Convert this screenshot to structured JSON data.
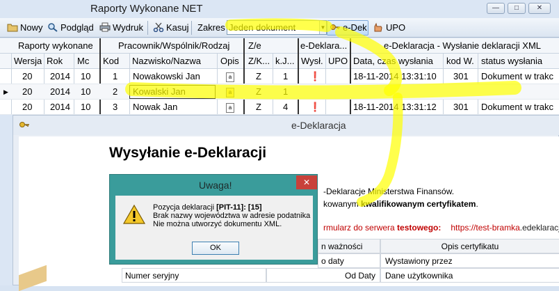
{
  "window": {
    "title": "Raporty Wykonane NET"
  },
  "toolbar": {
    "new_label": "Nowy",
    "preview_label": "Podgląd",
    "print_label": "Wydruk",
    "delete_label": "Kasuj",
    "range_label": "Zakres",
    "range_value": "Jeden dokument",
    "edek_label": "e-Dek",
    "upo_label": "UPO"
  },
  "grid": {
    "group_headers": [
      "Raporty wykonane",
      "Pracownik/Wspólnik/Rodzaj",
      "Z/e",
      "e-Deklara...",
      "e-Deklaracja - Wysłanie deklaracji XML"
    ],
    "columns": [
      "Wersja",
      "Rok",
      "Mc",
      "Kod",
      "Nazwisko/Nazwa",
      "Opis",
      "Z/K...",
      "k.J...",
      "Wysł.",
      "UPO",
      "Data, czas wysłania",
      "kod W.",
      "status wysłania"
    ],
    "rows": [
      {
        "wersja": "20",
        "rok": "2014",
        "mc": "10",
        "kod": "1",
        "nazwa": "Nowakowski Jan",
        "zk": "Z",
        "kj": "1",
        "sent": true,
        "data": "18-11-2014 13:31:10",
        "kodw": "301",
        "status": "Dokument w trakc"
      },
      {
        "wersja": "20",
        "rok": "2014",
        "mc": "10",
        "kod": "2",
        "nazwa": "Kowalski Jan",
        "zk": "Z",
        "kj": "1",
        "sent": false,
        "data": "",
        "kodw": "",
        "status": ""
      },
      {
        "wersja": "20",
        "rok": "2014",
        "mc": "10",
        "kod": "3",
        "nazwa": "Nowak Jan",
        "zk": "Z",
        "kj": "4",
        "sent": true,
        "data": "18-11-2014 13:31:12",
        "kodw": "301",
        "status": "Dokument w trakc"
      }
    ]
  },
  "edek_window": {
    "title": "e-Deklaracja",
    "heading": "Wysyłanie e-Deklaracji",
    "line1": "-Deklaracje Ministerstwa Finansów.",
    "line2_pre": "kowanym ",
    "line2_bold": "kwalifikowanym certyfikatem",
    "line2_post": ".",
    "line3_pre": "rmularz do serwera ",
    "line3_bold": "testowego:",
    "line3_url_a": "https://test-bramka",
    "line3_url_b": ".edeklaracje",
    "cert_headers": [
      "n ważności",
      "Opis certyfikatu"
    ],
    "cert_rows": [
      [
        "o daty",
        "Wystawiony przez"
      ],
      [
        "Numer seryjny",
        "Od Daty",
        "Dane użytkownika"
      ]
    ]
  },
  "dialog": {
    "title": "Uwaga!",
    "line1_pre": "Pozycja deklaracji ",
    "line1_bold": "[PIT-11]: [15]",
    "line2": "Brak nazwy województwa w adresie podatnika",
    "line3": "Nie można utworzyć dokumentu XML.",
    "ok_label": "OK"
  }
}
